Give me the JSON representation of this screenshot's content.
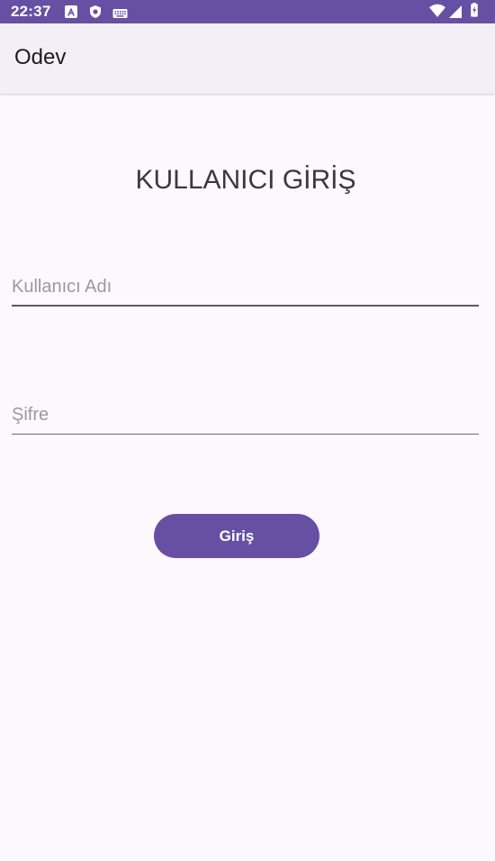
{
  "status_bar": {
    "time": "22:37",
    "background": "#674fa3",
    "icons": [
      "auto-icon",
      "shield-icon",
      "keyboard-icon",
      "wifi-icon",
      "signal-icon",
      "battery-icon"
    ]
  },
  "app_bar": {
    "title": "Odev"
  },
  "main": {
    "heading": "KULLANICI GİRİŞ",
    "username": {
      "placeholder": "Kullanıcı Adı",
      "value": ""
    },
    "password": {
      "placeholder": "Şifre",
      "value": ""
    },
    "login_button": "Giriş"
  },
  "colors": {
    "accent": "#674fa3",
    "background": "#fdf8fd",
    "app_bar": "#f2eff6"
  }
}
